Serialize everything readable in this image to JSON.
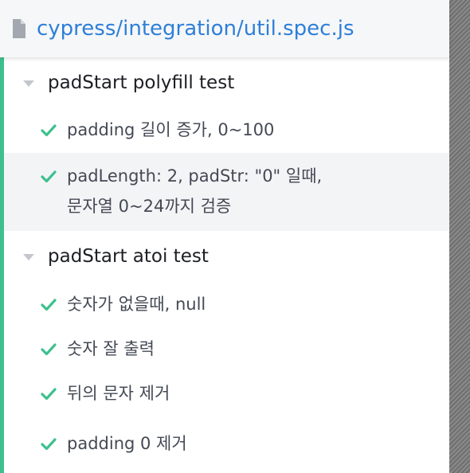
{
  "header": {
    "spec_icon": "file-icon",
    "spec_path": "cypress/integration/util.spec.js"
  },
  "colors": {
    "link": "#2e7fd8",
    "passed": "#3dc08d",
    "caret": "#c4c7cc",
    "text": "#434954"
  },
  "suites": [
    {
      "title": "padStart polyfill test",
      "state": "passed",
      "tests": [
        {
          "lines": [
            "padding 길이 증가, 0~100"
          ],
          "state": "passed"
        },
        {
          "lines": [
            "padLength: 2, padStr: \"0\" 일때,",
            "문자열 0~24까지 검증"
          ],
          "state": "passed"
        }
      ]
    },
    {
      "title": "padStart atoi test",
      "state": "passed",
      "tests": [
        {
          "lines": [
            "숫자가 없을때, null"
          ],
          "state": "passed"
        },
        {
          "lines": [
            "숫자 잘 출력"
          ],
          "state": "passed"
        },
        {
          "lines": [
            "뒤의 문자 제거"
          ],
          "state": "passed"
        },
        {
          "lines": [
            "padding 0 제거"
          ],
          "state": "passed"
        }
      ]
    }
  ]
}
